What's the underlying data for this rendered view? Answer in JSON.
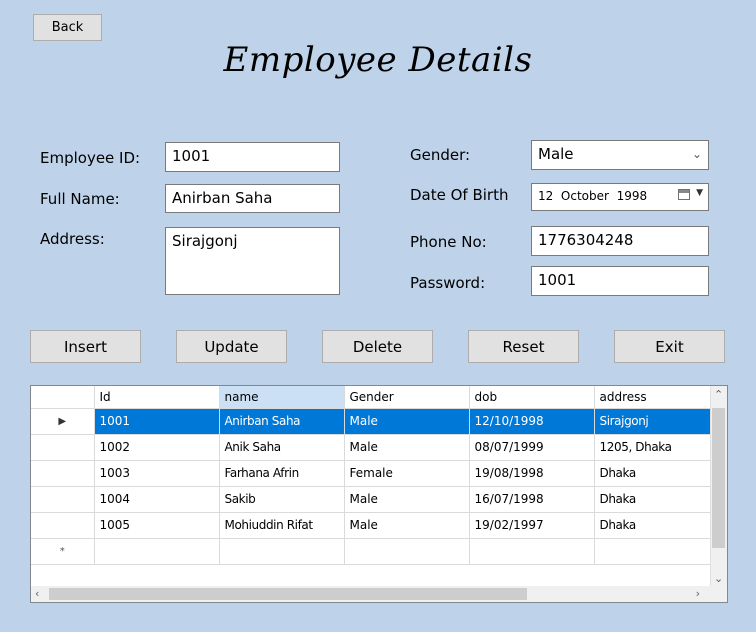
{
  "back_label": "Back",
  "title": "Employee Details",
  "form": {
    "employee_id": {
      "label": "Employee ID:",
      "value": "1001"
    },
    "full_name": {
      "label": "Full Name:",
      "value": "Anirban Saha"
    },
    "address": {
      "label": "Address:",
      "value": "Sirajgonj"
    },
    "gender": {
      "label": "Gender:",
      "value": "Male"
    },
    "dob": {
      "label": "Date Of Birth",
      "day": "12",
      "month": "October",
      "year": "1998"
    },
    "phone": {
      "label": "Phone No:",
      "value": "1776304248"
    },
    "password": {
      "label": "Password:",
      "value": "1001"
    }
  },
  "buttons": {
    "insert": "Insert",
    "update": "Update",
    "delete": "Delete",
    "reset": "Reset",
    "exit": "Exit"
  },
  "grid": {
    "columns": [
      "Id",
      "name",
      "Gender",
      "dob",
      "address"
    ],
    "rows": [
      {
        "id": "1001",
        "name": "Anirban Saha",
        "gender": "Male",
        "dob": "12/10/1998",
        "address": "Sirajgonj",
        "selected": true
      },
      {
        "id": "1002",
        "name": "Anik Saha",
        "gender": "Male",
        "dob": "08/07/1999",
        "address": "1205, Dhaka",
        "selected": false
      },
      {
        "id": "1003",
        "name": "Farhana Afrin",
        "gender": "Female",
        "dob": "19/08/1998",
        "address": "Dhaka",
        "selected": false
      },
      {
        "id": "1004",
        "name": "Sakib",
        "gender": "Male",
        "dob": "16/07/1998",
        "address": "Dhaka",
        "selected": false
      },
      {
        "id": "1005",
        "name": "Mohiuddin Rifat",
        "gender": "Male",
        "dob": "19/02/1997",
        "address": "Dhaka",
        "selected": false
      }
    ],
    "new_row_marker": "*",
    "current_row_marker": "▶"
  },
  "icons": {
    "chevron": "chevron-down-icon",
    "calendar": "calendar-icon",
    "scroll_up": "scroll-up-icon",
    "scroll_down": "scroll-down-icon",
    "scroll_left": "scroll-left-icon",
    "scroll_right": "scroll-right-icon"
  },
  "colors": {
    "background": "#bed3ea",
    "selection": "#0078d7",
    "button": "#e1e1e1"
  }
}
